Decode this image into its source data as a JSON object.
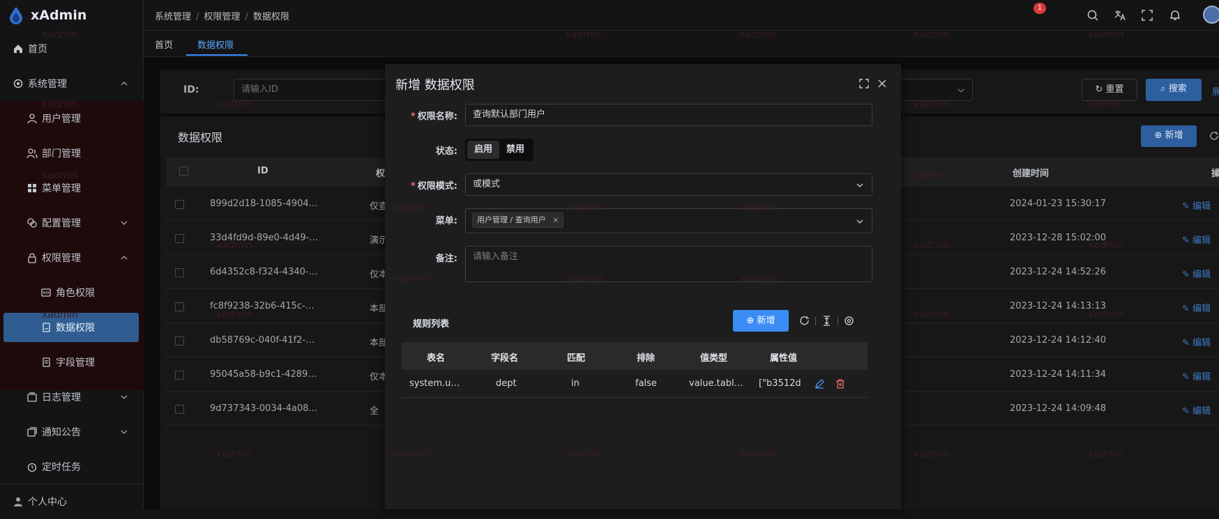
{
  "app": {
    "name": "xAdmin",
    "watermark": "xadmin"
  },
  "colors": {
    "accent": "#3c8cf5",
    "danger": "#f56c6c",
    "sidebar_active": "#2f5d92"
  },
  "sidebar": {
    "items": [
      {
        "label": "首页",
        "icon": "home-icon"
      },
      {
        "label": "系统管理",
        "icon": "gear-icon"
      },
      {
        "label": "用户管理",
        "icon": "user-icon"
      },
      {
        "label": "部门管理",
        "icon": "users-icon"
      },
      {
        "label": "菜单管理",
        "icon": "grid-icon"
      },
      {
        "label": "配置管理",
        "icon": "config-icon"
      },
      {
        "label": "权限管理",
        "icon": "lock-icon"
      },
      {
        "label": "角色权限",
        "icon": "role-icon"
      },
      {
        "label": "数据权限",
        "icon": "data-icon"
      },
      {
        "label": "字段管理",
        "icon": "field-icon"
      },
      {
        "label": "日志管理",
        "icon": "log-icon"
      },
      {
        "label": "通知公告",
        "icon": "notice-icon"
      },
      {
        "label": "定时任务",
        "icon": "clock-icon"
      },
      {
        "label": "个人中心",
        "icon": "person-icon"
      }
    ]
  },
  "header": {
    "breadcrumb": [
      "系统管理",
      "权限管理",
      "数据权限"
    ],
    "notification_count": "1"
  },
  "tabs": [
    {
      "label": "首页"
    },
    {
      "label": "数据权限"
    }
  ],
  "search": {
    "id_label": "ID:",
    "id_placeholder": "请输入ID",
    "reset_label": "重置",
    "search_label": "搜索",
    "more": "展"
  },
  "table": {
    "title": "数据权限",
    "add_label": "新增",
    "columns": [
      "ID",
      "权",
      "创建时间",
      "操"
    ],
    "rows": [
      {
        "id": "899d2d18-1085-4904…",
        "name": "仅查",
        "created": "2024-01-23 15:30:17",
        "action": "编辑"
      },
      {
        "id": "33d4fd9d-89e0-4d49-…",
        "name": "演示",
        "created": "2023-12-28 15:02:00",
        "action": "编辑"
      },
      {
        "id": "6d4352c8-f324-4340-…",
        "name": "仅本",
        "created": "2023-12-24 14:52:26",
        "action": "编辑"
      },
      {
        "id": "fc8f9238-32b6-415c-…",
        "name": "本部",
        "created": "2023-12-24 14:13:13",
        "action": "编辑"
      },
      {
        "id": "db58769c-040f-41f2-…",
        "name": "本部门",
        "created": "2023-12-24 14:12:40",
        "action": "编辑"
      },
      {
        "id": "95045a58-b9c1-4289…",
        "name": "仅本部门",
        "created": "2023-12-24 14:11:34",
        "action": "编辑"
      },
      {
        "id": "9d737343-0034-4a08…",
        "name": "全",
        "created": "2023-12-24 14:09:48",
        "action": "编辑"
      }
    ]
  },
  "dialog": {
    "title": "新增 数据权限",
    "name_label": "权限名称:",
    "name_value": "查询默认部门用户",
    "status_label": "状态:",
    "status_options": [
      "启用",
      "禁用"
    ],
    "mode_label": "权限模式:",
    "mode_value": "或模式",
    "menu_label": "菜单:",
    "menu_tag": "用户管理 / 查询用户",
    "remark_label": "备注:",
    "remark_placeholder": "请输入备注",
    "rules_title": "规则列表",
    "rules_add": "新增",
    "rules_columns": [
      "表名",
      "字段名",
      "匹配",
      "排除",
      "值类型",
      "属性值"
    ],
    "rules_rows": [
      {
        "table": "system.u…",
        "field": "dept",
        "match": "in",
        "exclude": "false",
        "value_type": "value.tabl…",
        "value": "[\"b3512d"
      }
    ]
  }
}
